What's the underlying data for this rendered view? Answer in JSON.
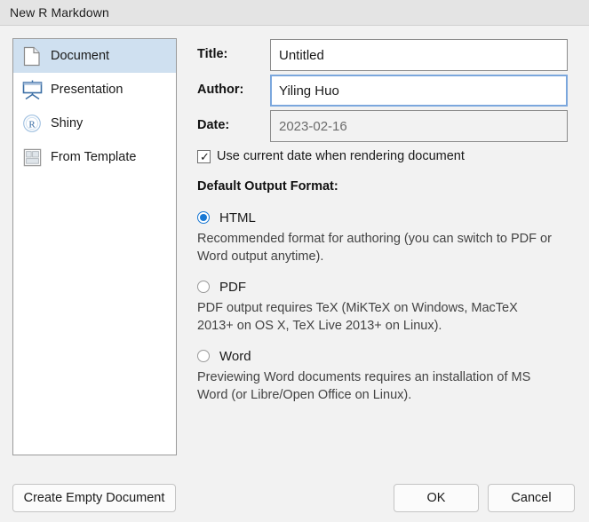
{
  "window": {
    "title": "New R Markdown"
  },
  "sidebar": {
    "items": [
      {
        "label": "Document",
        "icon": "document-icon",
        "selected": true
      },
      {
        "label": "Presentation",
        "icon": "presentation-icon",
        "selected": false
      },
      {
        "label": "Shiny",
        "icon": "shiny-r-icon",
        "selected": false
      },
      {
        "label": "From Template",
        "icon": "template-icon",
        "selected": false
      }
    ]
  },
  "form": {
    "title": {
      "label": "Title:",
      "value": "Untitled",
      "focused": false,
      "readonly": false
    },
    "author": {
      "label": "Author:",
      "value": "Yiling Huo",
      "focused": true,
      "readonly": false
    },
    "date": {
      "label": "Date:",
      "value": "2023-02-16",
      "focused": false,
      "readonly": true
    },
    "use_current_date": {
      "label": "Use current date when rendering document",
      "checked": true,
      "tick": "✓"
    },
    "output_format": {
      "heading": "Default Output Format:",
      "options": [
        {
          "label": "HTML",
          "selected": true,
          "description": "Recommended format for authoring (you can switch to PDF or Word output anytime)."
        },
        {
          "label": "PDF",
          "selected": false,
          "description": "PDF output requires TeX (MiKTeX on Windows, MacTeX 2013+ on OS X, TeX Live 2013+ on Linux)."
        },
        {
          "label": "Word",
          "selected": false,
          "description": "Previewing Word documents requires an installation of MS Word (or Libre/Open Office on Linux)."
        }
      ]
    }
  },
  "footer": {
    "create_empty_label": "Create Empty Document",
    "ok_label": "OK",
    "cancel_label": "Cancel"
  },
  "colors": {
    "titlebar_bg": "#e4e4e4",
    "dialog_bg": "#f2f2f2",
    "selection_blue": "#cfe0f0",
    "focus_border": "#7ba7dd",
    "radio_blue": "#1878d4",
    "icon_blue": "#3b6ea5",
    "panel_border": "#9a9a9a"
  }
}
